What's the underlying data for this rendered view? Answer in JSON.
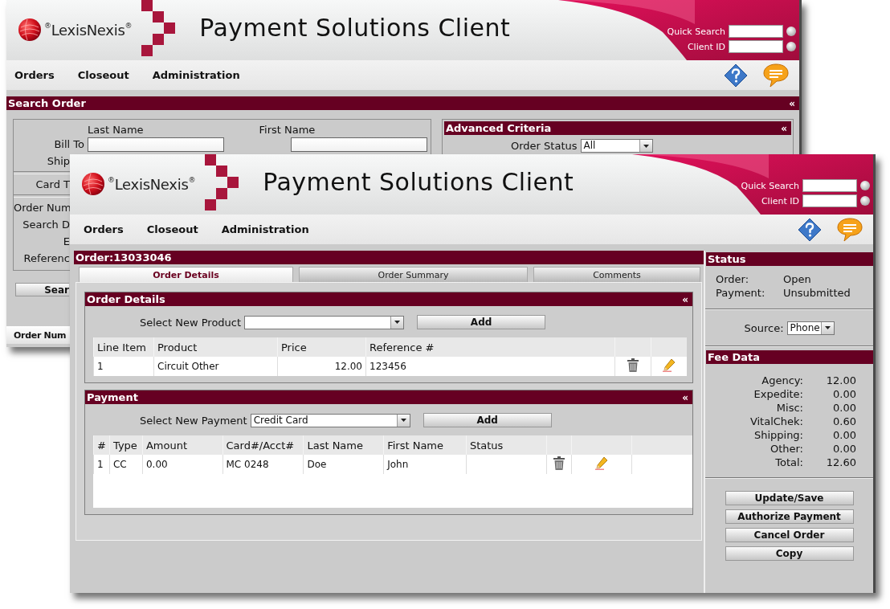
{
  "back_window": {
    "logo": "$^{®}$LexisNexis$^{®}$",
    "title": "Payment Solutions Client",
    "quick_search": [
      {
        "label": "Quick Search"
      },
      {
        "label": "Client ID"
      }
    ],
    "menu": [
      "Orders",
      "Closeout",
      "Administration"
    ],
    "section": {
      "title": "Search Order",
      "collapse": "«"
    },
    "name_headers": [
      "Last Name",
      "First Name"
    ],
    "bill_to": "Bill To",
    "form_labels": [
      "Ship",
      "Card T",
      "Order Num",
      "Search D",
      "E",
      "Referenc"
    ],
    "search_button": "Sear",
    "advanced": {
      "title": "Advanced Criteria",
      "collapse": "«",
      "order_status": {
        "label": "Order Status",
        "value": "All"
      }
    },
    "results_column": "Order Num"
  },
  "front_window": {
    "logo": "$^{®}$LexisNexis$^{®}$",
    "title": "Payment Solutions Client",
    "quick_search": [
      {
        "label": "Quick Search"
      },
      {
        "label": "Client ID"
      }
    ],
    "menu": [
      "Orders",
      "Closeout",
      "Administration"
    ],
    "order_title": "Order:13033046",
    "tabs": [
      {
        "label": "Order Details",
        "selected": true
      },
      {
        "label": "Order Summary",
        "selected": false
      },
      {
        "label": "Comments",
        "selected": false
      }
    ],
    "order_details": {
      "title": "Order Details",
      "collapse": "«",
      "select_label": "Select New Product",
      "add_button": "Add",
      "columns": [
        "Line Item",
        "Product",
        "Price",
        "Reference #"
      ],
      "rows": [
        {
          "cells": [
            "1",
            "Circuit Other",
            "12.00",
            "123456"
          ]
        }
      ]
    },
    "payment": {
      "title": "Payment",
      "collapse": "«",
      "select_label": "Select New Payment",
      "select_value": "Credit Card",
      "add_button": "Add",
      "columns": [
        "#",
        "Type",
        "Amount",
        "Card#/Acct#",
        "Last Name",
        "First Name",
        "Status"
      ],
      "rows": [
        {
          "cells": [
            "1",
            "CC",
            "0.00",
            "MC 0248",
            "Doe",
            "John"
          ]
        }
      ]
    },
    "status": {
      "title": "Status",
      "items": [
        {
          "label": "Order:",
          "value": "Open"
        },
        {
          "label": "Payment:",
          "value": "Unsubmitted"
        }
      ]
    },
    "source": {
      "label": "Source:",
      "value": "Phone"
    },
    "fee_data": {
      "title": "Fee Data",
      "rows": [
        {
          "label": "Agency:",
          "value": "12.00"
        },
        {
          "label": "Expedite:",
          "value": "0.00"
        },
        {
          "label": "Misc:",
          "value": "0.00"
        },
        {
          "label": "VitalChek:",
          "value": "0.60"
        },
        {
          "label": "Shipping:",
          "value": "0.00"
        },
        {
          "label": "Other:",
          "value": "0.00"
        },
        {
          "label": "Total:",
          "value": "12.60"
        }
      ]
    },
    "actions": [
      "Update/Save",
      "Authorize Payment",
      "Cancel Order",
      "Copy"
    ]
  }
}
